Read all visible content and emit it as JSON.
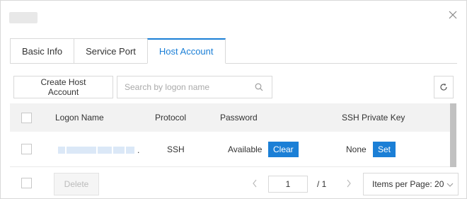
{
  "dialog": {
    "close_icon": "close-icon"
  },
  "tabs": [
    {
      "label": "Basic Info"
    },
    {
      "label": "Service Port"
    },
    {
      "label": "Host Account"
    }
  ],
  "toolbar": {
    "create_label": "Create Host Account",
    "search_placeholder": "Search by logon name",
    "search_icon": "search-icon",
    "refresh_icon": "refresh-icon"
  },
  "table": {
    "columns": [
      "Logon Name",
      "Protocol",
      "Password",
      "SSH Private Key"
    ],
    "rows": [
      {
        "logon_name_suffix": ".",
        "protocol": "SSH",
        "password_status": "Available",
        "password_action": "Clear",
        "ssh_key_status": "None",
        "ssh_key_action": "Set"
      }
    ]
  },
  "footer": {
    "delete_label": "Delete",
    "current_page": "1",
    "total_pages": "/ 1",
    "per_page_label": "Items per Page: 20"
  },
  "colors": {
    "accent": "#1b7fd6",
    "header_bg": "#f2f2f2",
    "border": "#d9d9d9"
  }
}
